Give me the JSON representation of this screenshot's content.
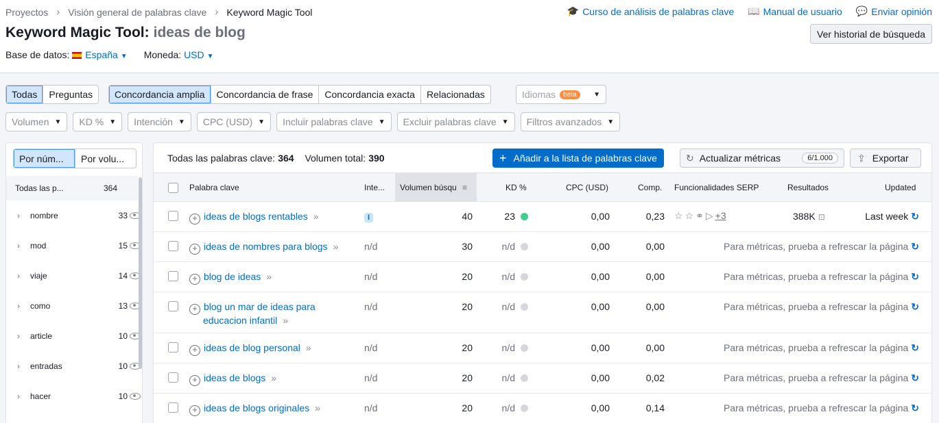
{
  "breadcrumb": {
    "items": [
      "Proyectos",
      "Visión general de palabras clave",
      "Keyword Magic Tool"
    ]
  },
  "top_links": [
    "Curso de análisis de palabras clave",
    "Manual de usuario",
    "Enviar opinión"
  ],
  "title": {
    "tool": "Keyword Magic Tool:",
    "query": "ideas de blog"
  },
  "history_button": "Ver historial de búsqueda",
  "database": {
    "label": "Base de datos:",
    "value": "España"
  },
  "currency": {
    "label": "Moneda:",
    "value": "USD"
  },
  "tabs_type": [
    "Todas",
    "Preguntas"
  ],
  "tabs_match": [
    "Concordancia amplia",
    "Concordancia de frase",
    "Concordancia exacta",
    "Relacionadas"
  ],
  "languages": {
    "label": "Idiomas",
    "badge": "beta"
  },
  "filters": [
    "Volumen",
    "KD %",
    "Intención",
    "CPC (USD)",
    "Incluir palabras clave",
    "Excluir palabras clave",
    "Filtros avanzados"
  ],
  "sidebar": {
    "tabs": [
      "Por núm...",
      "Por volu..."
    ],
    "header": {
      "label": "Todas las p...",
      "count": "364"
    },
    "groups": [
      {
        "name": "nombre",
        "count": "33"
      },
      {
        "name": "mod",
        "count": "15"
      },
      {
        "name": "viaje",
        "count": "14"
      },
      {
        "name": "como",
        "count": "13"
      },
      {
        "name": "article",
        "count": "10"
      },
      {
        "name": "entradas",
        "count": "10"
      },
      {
        "name": "hacer",
        "count": "10"
      }
    ]
  },
  "summary": {
    "total_label": "Todas las palabras clave:",
    "total": "364",
    "volume_label": "Volumen total:",
    "volume": "390"
  },
  "buttons": {
    "add": "Añadir a la lista de palabras clave",
    "update": "Actualizar métricas",
    "update_badge": "6/1.000",
    "export": "Exportar"
  },
  "table": {
    "headers": {
      "keyword": "Palabra clave",
      "intent": "Inte...",
      "volume": "Volumen búsqu",
      "kd": "KD %",
      "cpc": "CPC (USD)",
      "comp": "Comp.",
      "serp": "Funcionalidades SERP",
      "results": "Resultados",
      "updated": "Updated"
    },
    "rows": [
      {
        "kw1": "ideas de blogs rentables",
        "kw2": "",
        "intent": "I",
        "volume": "40",
        "kd": "23",
        "cpc": "0,00",
        "comp": "0,23",
        "serp_more": "+3",
        "results": "388K",
        "updated": "Last week"
      },
      {
        "kw1": "ideas de nombres para blogs",
        "kw2": "",
        "intent": "n/d",
        "volume": "30",
        "kd": "n/d",
        "cpc": "0,00",
        "comp": "0,00",
        "msg": "Para métricas, prueba a refrescar la página"
      },
      {
        "kw1": "blog de ideas",
        "kw2": "",
        "intent": "n/d",
        "volume": "20",
        "kd": "n/d",
        "cpc": "0,00",
        "comp": "0,00",
        "msg": "Para métricas, prueba a refrescar la página"
      },
      {
        "kw1": "blog un mar de ideas para",
        "kw2": "educacion infantil",
        "intent": "n/d",
        "volume": "20",
        "kd": "n/d",
        "cpc": "0,00",
        "comp": "0,00",
        "msg": "Para métricas, prueba a refrescar la página"
      },
      {
        "kw1": "ideas de blog personal",
        "kw2": "",
        "intent": "n/d",
        "volume": "20",
        "kd": "n/d",
        "cpc": "0,00",
        "comp": "0,00",
        "msg": "Para métricas, prueba a refrescar la página"
      },
      {
        "kw1": "ideas de blogs",
        "kw2": "",
        "intent": "n/d",
        "volume": "20",
        "kd": "n/d",
        "cpc": "0,00",
        "comp": "0,02",
        "msg": "Para métricas, prueba a refrescar la página"
      },
      {
        "kw1": "ideas de blogs originales",
        "kw2": "",
        "intent": "n/d",
        "volume": "20",
        "kd": "n/d",
        "cpc": "0,00",
        "comp": "0,14",
        "msg": "Para métricas, prueba a refrescar la página"
      }
    ]
  },
  "colors": {
    "accent": "#006dca",
    "kd_easy": "#3ecf8e",
    "kd_na": "#d5d7dc",
    "active_tab": "#d1e6fa"
  }
}
